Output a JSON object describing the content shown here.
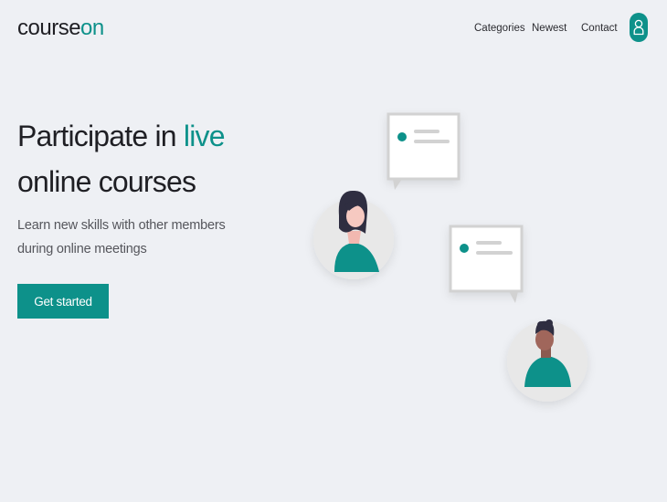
{
  "header": {
    "logo_text": "course",
    "logo_accent": "on",
    "nav": [
      {
        "label": "Categories"
      },
      {
        "label": "Newest"
      },
      {
        "label": "Contact"
      }
    ],
    "user_icon": "person-outline-icon"
  },
  "hero": {
    "headline_part1": "Participate in ",
    "headline_accent": "live",
    "headline_line2": "online courses",
    "subtext": "Learn new skills with other members during online meetings",
    "cta_label": "Get started"
  },
  "colors": {
    "accent": "#0d918a",
    "background": "#eef0f4",
    "text": "#1f1f24"
  }
}
